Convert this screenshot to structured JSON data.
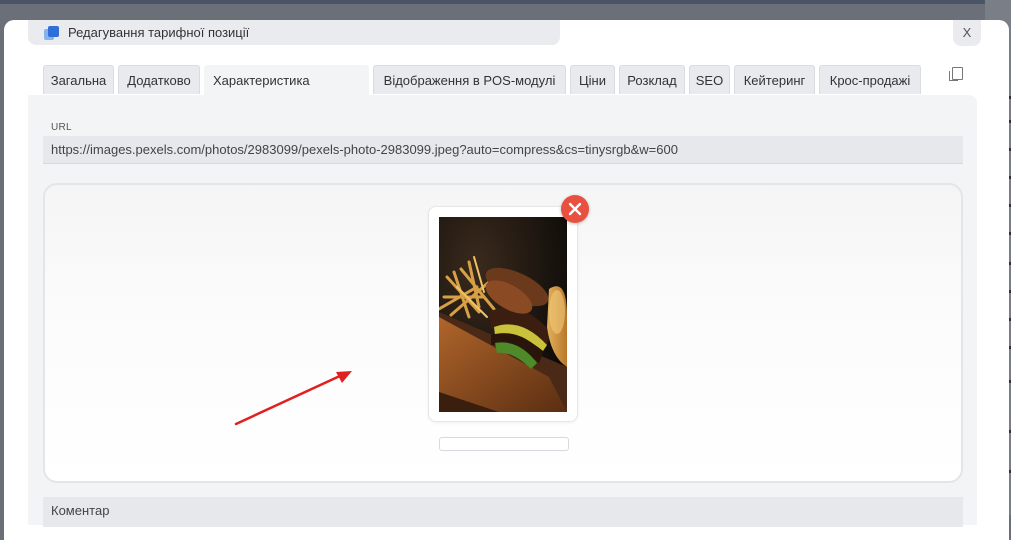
{
  "dialog": {
    "title": "Редагування тарифної позиції",
    "close_label": "X"
  },
  "tabs": [
    {
      "label": "Загальна"
    },
    {
      "label": "Додатково"
    },
    {
      "label": "Характеристика",
      "active": true
    },
    {
      "label": "Відображення в POS-модулі"
    },
    {
      "label": "Ціни"
    },
    {
      "label": "Розклад"
    },
    {
      "label": "SEO"
    },
    {
      "label": "Кейтеринг"
    },
    {
      "label": "Крос-продажі"
    }
  ],
  "url_field": {
    "label": "URL",
    "value": "https://images.pexels.com/photos/2983099/pexels-photo-2983099.jpeg?auto=compress&cs=tinysrgb&w=600"
  },
  "image": {
    "subject": "burger-and-fries-photo",
    "caption_value": ""
  },
  "comment_field": {
    "label": "Коментар"
  },
  "colors": {
    "accent_blue": "#2f6fd8",
    "remove_red": "#e8503f",
    "arrow_red": "#e02020",
    "panel_bg": "#f3f4f6",
    "tab_bg": "#e8eaed"
  },
  "icons": {
    "title": "document-stack-icon",
    "copy": "copy-icon",
    "remove": "close-icon"
  }
}
